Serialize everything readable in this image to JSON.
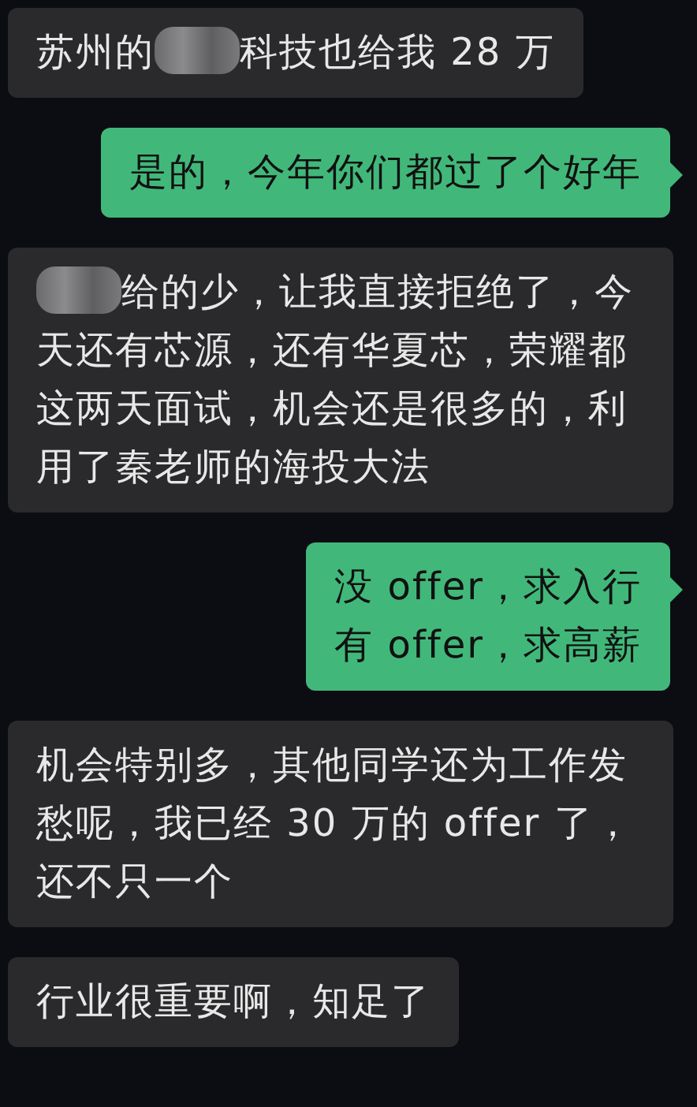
{
  "messages": [
    {
      "kind": "received",
      "parts": [
        {
          "kind": "text",
          "text": "苏州的"
        },
        {
          "kind": "blur"
        },
        {
          "kind": "text",
          "text": "科技也给我 28 万"
        }
      ]
    },
    {
      "kind": "sent",
      "parts": [
        {
          "kind": "text",
          "text": "是的，今年你们都过了个好年"
        }
      ]
    },
    {
      "kind": "received",
      "parts": [
        {
          "kind": "blur"
        },
        {
          "kind": "text",
          "text": "给的少，让我直接拒绝了，今"
        },
        {
          "kind": "line",
          "text": "天还有芯源，还有华夏芯，荣耀都这两天面试，机会还是很多的，利用了秦老师的海投大法"
        }
      ]
    },
    {
      "kind": "sent",
      "parts": [
        {
          "kind": "line",
          "text": "没 offer，求入行"
        },
        {
          "kind": "line",
          "text": "有 offer，求高薪"
        }
      ]
    },
    {
      "kind": "received",
      "parts": [
        {
          "kind": "text",
          "text": "机会特别多，其他同学还为工作发愁呢，我已经 30 万的 offer 了，还不只一个"
        }
      ]
    },
    {
      "kind": "received",
      "parts": [
        {
          "kind": "text",
          "text": "行业很重要啊，知足了"
        }
      ]
    }
  ]
}
